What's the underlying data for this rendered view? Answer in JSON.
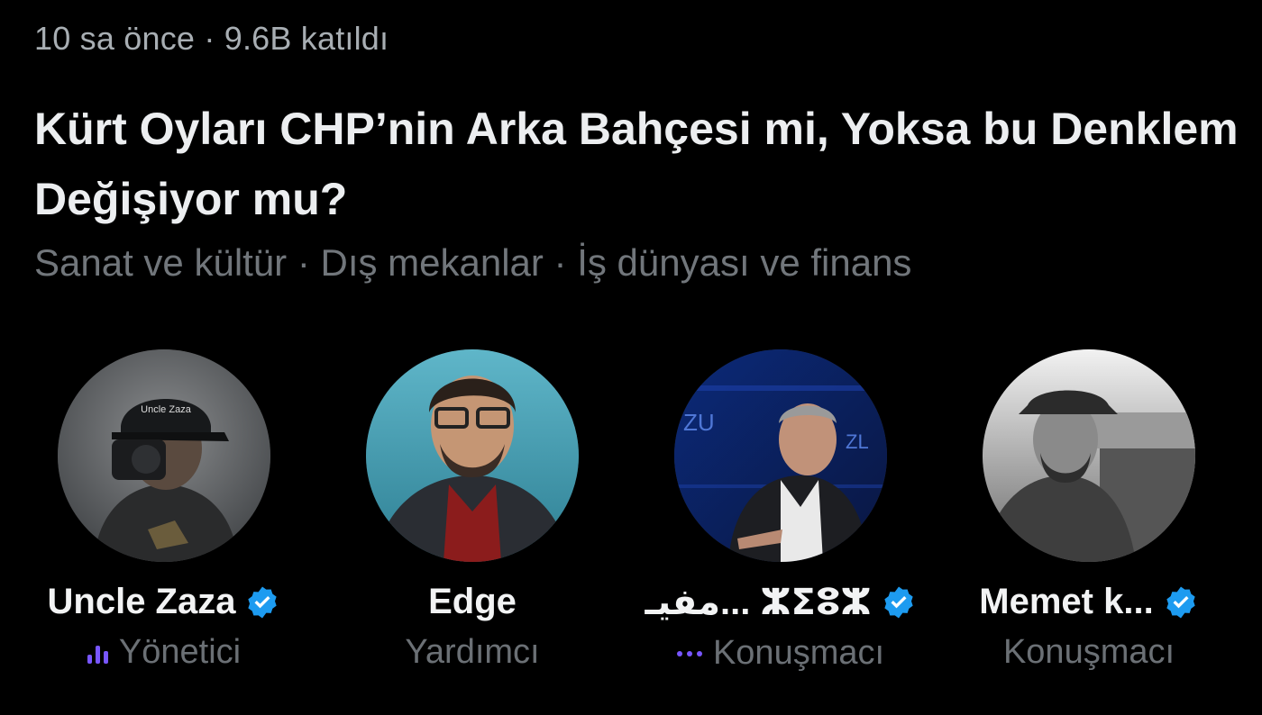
{
  "space": {
    "meta": "10 sa önce · 9.6B katıldı",
    "title": "Kürt Oyları CHP’nin Arka Bahçesi mi, Yoksa bu Denklem Değişiyor mu?",
    "topics": "Sanat ve kültür · Dış mekanlar · İş dünyası ve finans"
  },
  "participants": [
    {
      "name": "Uncle Zaza",
      "role": "Yönetici",
      "verified": true,
      "role_icon": "speaking-bars-icon",
      "avatar_cap_text": "Uncle Zaza"
    },
    {
      "name": "Edge",
      "role": "Yardımcı",
      "verified": false
    },
    {
      "name": "مفيـ... ⵣⵉⵓⵣ",
      "role": "Konuşmacı",
      "verified": true,
      "role_icon": "idle-dots-icon"
    },
    {
      "name": "Memet k...",
      "role": "Konuşmacı",
      "verified": true
    }
  ],
  "colors": {
    "verified": "#1d9bf0",
    "accent": "#7856ff",
    "muted": "#71767b"
  }
}
